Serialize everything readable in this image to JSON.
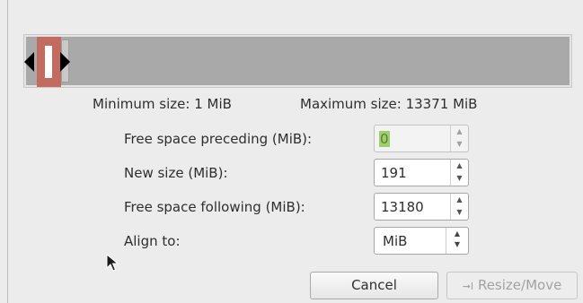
{
  "size_limits": {
    "minimum": "Minimum size: 1 MiB",
    "maximum": "Maximum size: 13371 MiB"
  },
  "fields": {
    "preceding": {
      "label": "Free space preceding (MiB):",
      "value": "0"
    },
    "new_size": {
      "label": "New size (MiB):",
      "value": "191"
    },
    "following": {
      "label": "Free space following (MiB):",
      "value": "13180"
    },
    "align": {
      "label": "Align to:",
      "value": "MiB"
    }
  },
  "buttons": {
    "cancel": "Cancel",
    "resize_move": "Resize/Move"
  },
  "colors": {
    "partition": "#c46b5f",
    "unallocated": "#a9a9a9"
  }
}
